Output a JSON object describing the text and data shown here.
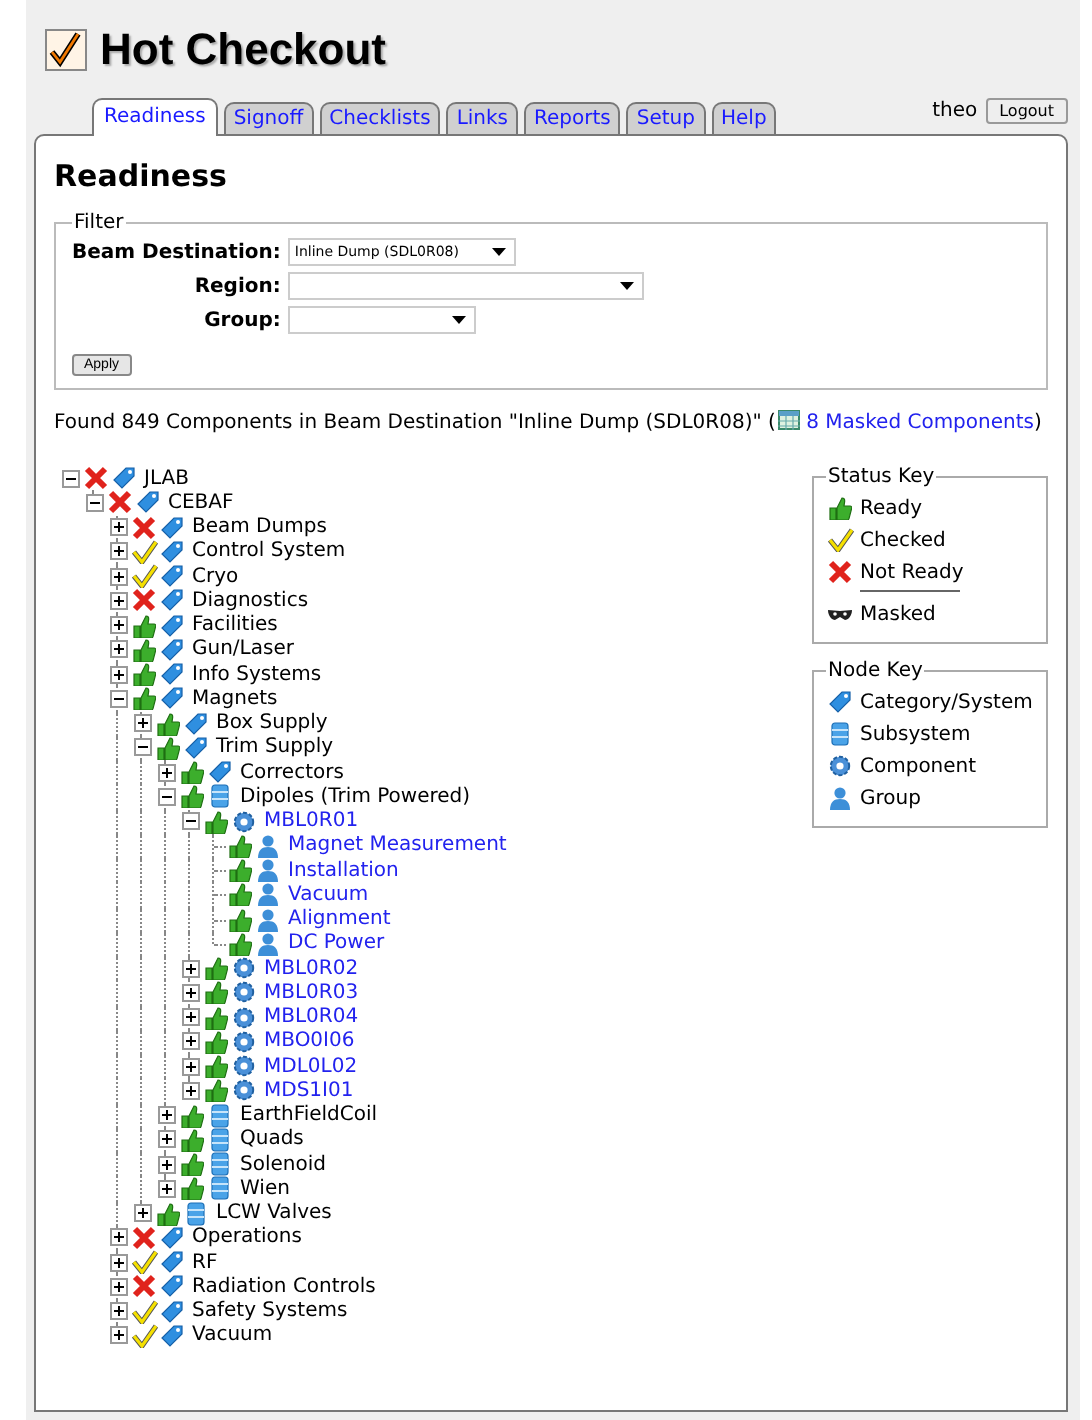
{
  "header": {
    "title": "Hot Checkout"
  },
  "tabs": [
    {
      "label": "Readiness",
      "selected": true
    },
    {
      "label": "Signoff",
      "selected": false
    },
    {
      "label": "Checklists",
      "selected": false
    },
    {
      "label": "Links",
      "selected": false
    },
    {
      "label": "Reports",
      "selected": false
    },
    {
      "label": "Setup",
      "selected": false
    },
    {
      "label": "Help",
      "selected": false
    }
  ],
  "user": {
    "name": "theo",
    "logout_button": "Logout"
  },
  "page_title": "Readiness",
  "filter": {
    "legend": "Filter",
    "fields": [
      {
        "label": "Beam Destination:",
        "value": "Inline Dump (SDL0R08)"
      },
      {
        "label": "Region:"
      },
      {
        "label": "Group:"
      }
    ],
    "apply_button": "Apply"
  },
  "summary": {
    "text": "Found 849 Components in Beam Destination \"Inline Dump (SDL0R08)\" (",
    "link": "8 Masked Components",
    "close": ")"
  },
  "tree": [
    {
      "name": "JLAB",
      "ready": false,
      "checked": false,
      "kind": "category",
      "expanded": true,
      "children": [
        {
          "name": "CEBAF",
          "ready": false,
          "checked": false,
          "kind": "category",
          "expanded": true,
          "children": [
            {
              "name": "Beam Dumps",
              "ready": false,
              "checked": false,
              "kind": "category",
              "expanded": false
            },
            {
              "name": "Control System",
              "ready": false,
              "checked": true,
              "kind": "category",
              "expanded": false
            },
            {
              "name": "Cryo",
              "ready": false,
              "checked": true,
              "kind": "category",
              "expanded": false
            },
            {
              "name": "Diagnostics",
              "ready": false,
              "checked": false,
              "kind": "category",
              "expanded": false
            },
            {
              "name": "Facilities",
              "ready": true,
              "checked": false,
              "kind": "category",
              "expanded": false
            },
            {
              "name": "Gun/Laser",
              "ready": true,
              "checked": false,
              "kind": "category",
              "expanded": false
            },
            {
              "name": "Info Systems",
              "ready": true,
              "checked": false,
              "kind": "category",
              "expanded": false
            },
            {
              "name": "Magnets",
              "ready": true,
              "checked": false,
              "kind": "category",
              "expanded": true,
              "children": [
                {
                  "name": "Box Supply",
                  "ready": true,
                  "checked": false,
                  "kind": "category",
                  "expanded": false
                },
                {
                  "name": "Trim Supply",
                  "ready": true,
                  "checked": false,
                  "kind": "category",
                  "expanded": true,
                  "children": [
                    {
                      "name": "Correctors",
                      "ready": true,
                      "checked": false,
                      "kind": "category",
                      "expanded": false
                    },
                    {
                      "name": "Dipoles (Trim Powered)",
                      "ready": true,
                      "checked": false,
                      "kind": "subsystem",
                      "expanded": true,
                      "children": [
                        {
                          "name": "MBL0R01",
                          "ready": true,
                          "checked": false,
                          "kind": "component",
                          "expanded": true,
                          "children": [
                            {
                              "name": "Magnet Measurement",
                              "ready": true,
                              "checked": false,
                              "kind": "group"
                            },
                            {
                              "name": "Installation",
                              "ready": true,
                              "checked": false,
                              "kind": "group"
                            },
                            {
                              "name": "Vacuum",
                              "ready": true,
                              "checked": false,
                              "kind": "group"
                            },
                            {
                              "name": "Alignment",
                              "ready": true,
                              "checked": false,
                              "kind": "group"
                            },
                            {
                              "name": "DC Power",
                              "ready": true,
                              "checked": false,
                              "kind": "group"
                            }
                          ]
                        },
                        {
                          "name": "MBL0R02",
                          "ready": true,
                          "checked": false,
                          "kind": "component",
                          "expanded": false
                        },
                        {
                          "name": "MBL0R03",
                          "ready": true,
                          "checked": false,
                          "kind": "component",
                          "expanded": false
                        },
                        {
                          "name": "MBL0R04",
                          "ready": true,
                          "checked": false,
                          "kind": "component",
                          "expanded": false
                        },
                        {
                          "name": "MBO0I06",
                          "ready": true,
                          "checked": false,
                          "kind": "component",
                          "expanded": false
                        },
                        {
                          "name": "MDL0L02",
                          "ready": true,
                          "checked": false,
                          "kind": "component",
                          "expanded": false
                        },
                        {
                          "name": "MDS1I01",
                          "ready": true,
                          "checked": false,
                          "kind": "component",
                          "expanded": false
                        }
                      ]
                    },
                    {
                      "name": "EarthFieldCoil",
                      "ready": true,
                      "checked": false,
                      "kind": "subsystem",
                      "expanded": false
                    },
                    {
                      "name": "Quads",
                      "ready": true,
                      "checked": false,
                      "kind": "subsystem",
                      "expanded": false
                    },
                    {
                      "name": "Solenoid",
                      "ready": true,
                      "checked": false,
                      "kind": "subsystem",
                      "expanded": false
                    },
                    {
                      "name": "Wien",
                      "ready": true,
                      "checked": false,
                      "kind": "subsystem",
                      "expanded": false
                    }
                  ]
                },
                {
                  "name": "LCW Valves",
                  "ready": true,
                  "checked": false,
                  "kind": "subsystem",
                  "expanded": false
                }
              ]
            },
            {
              "name": "Operations",
              "ready": false,
              "checked": false,
              "kind": "category",
              "expanded": false
            },
            {
              "name": "RF",
              "ready": false,
              "checked": true,
              "kind": "category",
              "expanded": false
            },
            {
              "name": "Radiation Controls",
              "ready": false,
              "checked": false,
              "kind": "category",
              "expanded": false
            },
            {
              "name": "Safety Systems",
              "ready": false,
              "checked": true,
              "kind": "category",
              "expanded": false
            },
            {
              "name": "Vacuum",
              "ready": false,
              "checked": true,
              "kind": "category",
              "expanded": false
            }
          ]
        }
      ]
    }
  ],
  "status_key": {
    "title": "Status Key",
    "items": [
      {
        "kind": "ready",
        "label": "Ready"
      },
      {
        "kind": "checked",
        "label": "Checked"
      },
      {
        "kind": "not_ready",
        "label": "Not Ready"
      },
      {
        "kind": "masked",
        "label": "Masked"
      }
    ]
  },
  "node_key": {
    "title": "Node Key",
    "items": [
      {
        "kind": "category",
        "label": "Category/System"
      },
      {
        "kind": "subsystem",
        "label": "Subsystem"
      },
      {
        "kind": "component",
        "label": "Component"
      },
      {
        "kind": "group",
        "label": "Group"
      }
    ]
  }
}
